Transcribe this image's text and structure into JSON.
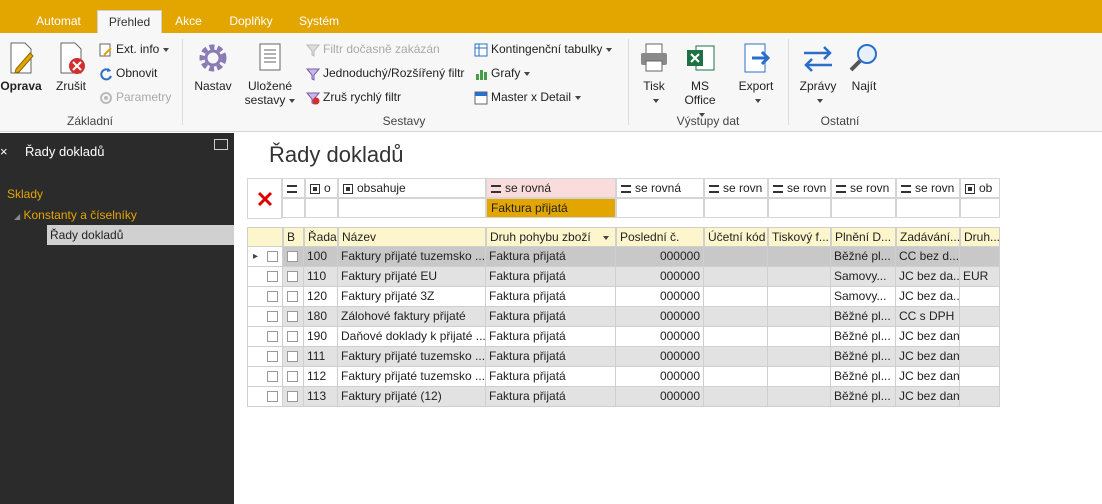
{
  "ribbon": {
    "tabs": [
      {
        "label": "Automat",
        "active": false
      },
      {
        "label": "Přehled",
        "active": true
      },
      {
        "label": "Akce",
        "active": false
      },
      {
        "label": "Doplňky",
        "active": false
      },
      {
        "label": "Systém",
        "active": false
      }
    ],
    "groups": {
      "zakladni": "Základní",
      "sestavy": "Sestavy",
      "vystupy": "Výstupy dat",
      "ostatni": "Ostatní"
    },
    "buttons": {
      "oprava": "Oprava",
      "zrusit": "Zrušit",
      "ext_info": "Ext. info",
      "obnovit": "Obnovit",
      "parametry": "Parametry",
      "nastav": "Nastav",
      "ulozene_1": "Uložené",
      "ulozene_2": "sestavy",
      "filtr_docasne": "Filtr dočasně zakázán",
      "jednoduchy": "Jednoduchý/Rozšířený filtr",
      "zrus_rychly": "Zruš rychlý filtr",
      "kontingencni": "Kontingenční tabulky",
      "grafy": "Grafy",
      "master": "Master x Detail",
      "tisk": "Tisk",
      "ms_1": "MS",
      "ms_2": "Office",
      "export": "Export",
      "zpravy": "Zprávy",
      "najit": "Najít"
    }
  },
  "left_panel": {
    "title": "Řady dokladů",
    "close": "×",
    "tree": [
      {
        "label": "Sklady",
        "level": 0
      },
      {
        "label": "Konstanty a číselníky",
        "level": 1
      },
      {
        "label": "Řady dokladů",
        "level": 2,
        "selected": true
      }
    ]
  },
  "page_title": "Řady dokladů",
  "filter": {
    "ops": [
      "o",
      "obsahuje",
      "se rovná",
      "se rovná",
      "se rovn",
      "se rovn",
      "se rovn",
      "se rovn",
      "ob"
    ],
    "values": [
      "",
      "",
      "Faktura přijatá",
      "",
      "",
      "",
      "",
      "",
      ""
    ]
  },
  "grid": {
    "headers": [
      "B",
      "Řada",
      "Název",
      "Druh pohybu zboží",
      "Poslední č.",
      "Účetní kód",
      "Tiskový f...",
      "Plnění D...",
      "Zadávání...",
      "Druh..."
    ],
    "rows": [
      [
        "100",
        "Faktury přijaté tuzemsko ...",
        "Faktura přijatá",
        "000000",
        "",
        "",
        "Běžné pl...",
        "CC bez d...",
        ""
      ],
      [
        "110",
        "Faktury přijaté EU",
        "Faktura přijatá",
        "000000",
        "",
        "",
        "Samovy...",
        "JC bez da...",
        "EUR"
      ],
      [
        "120",
        "Faktury přijaté 3Z",
        "Faktura přijatá",
        "000000",
        "",
        "",
        "Samovy...",
        "JC bez da...",
        ""
      ],
      [
        "180",
        "Zálohové faktury přijaté",
        "Faktura přijatá",
        "000000",
        "",
        "",
        "Běžné pl...",
        "CC s DPH",
        ""
      ],
      [
        "190",
        "Daňové doklady k přijaté ...",
        "Faktura přijatá",
        "000000",
        "",
        "",
        "Běžné pl...",
        "JC bez daní",
        ""
      ],
      [
        "111",
        "Faktury přijaté tuzemsko ...",
        "Faktura přijatá",
        "000000",
        "",
        "",
        "Běžné pl...",
        "JC bez daní",
        ""
      ],
      [
        "112",
        "Faktury přijaté tuzemsko ...",
        "Faktura přijatá",
        "000000",
        "",
        "",
        "Běžné pl...",
        "JC bez daní",
        ""
      ],
      [
        "113",
        "Faktury přijaté (12)",
        "Faktura přijatá",
        "000000",
        "",
        "",
        "Běžné pl...",
        "JC bez daní",
        ""
      ]
    ]
  },
  "colors": {
    "accent": "#e3a600",
    "left_panel_bg": "#2b2b2b",
    "row_alt": "#e2e2e2",
    "row_selected": "#c8c8c8",
    "header_bg": "#fdf6cc"
  }
}
